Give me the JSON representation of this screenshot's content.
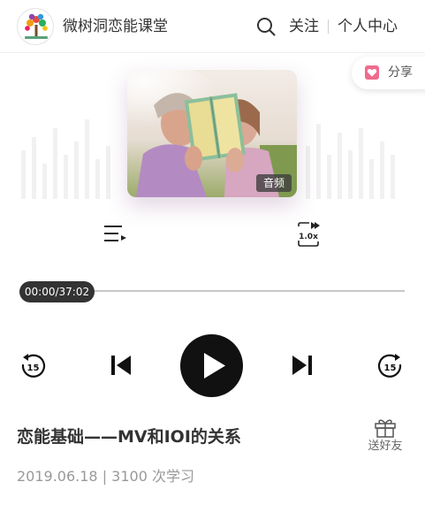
{
  "header": {
    "app_title": "微树洞恋能课堂",
    "follow_label": "关注",
    "personal_center_label": "个人中心",
    "search_icon": "search-icon"
  },
  "share": {
    "label": "分享",
    "icon": "share-heart-icon"
  },
  "cover": {
    "badge": "音频",
    "image": "couple-holding-book-photo"
  },
  "controls": {
    "speed_label": "1.0x",
    "back_label": "15",
    "forward_label": "15",
    "playlist_icon": "playlist-icon",
    "play_icon": "play-icon"
  },
  "player": {
    "time": "00:00/37:02",
    "progress": 0
  },
  "episode": {
    "title": "恋能基础——MV和IOI的关系",
    "meta": "2019.06.18 | 3100 次学习",
    "gift_label": "送好友"
  },
  "colors": {
    "accent_pink": "#e8577e",
    "dark": "#111111",
    "text": "#333333",
    "muted": "#999999"
  }
}
